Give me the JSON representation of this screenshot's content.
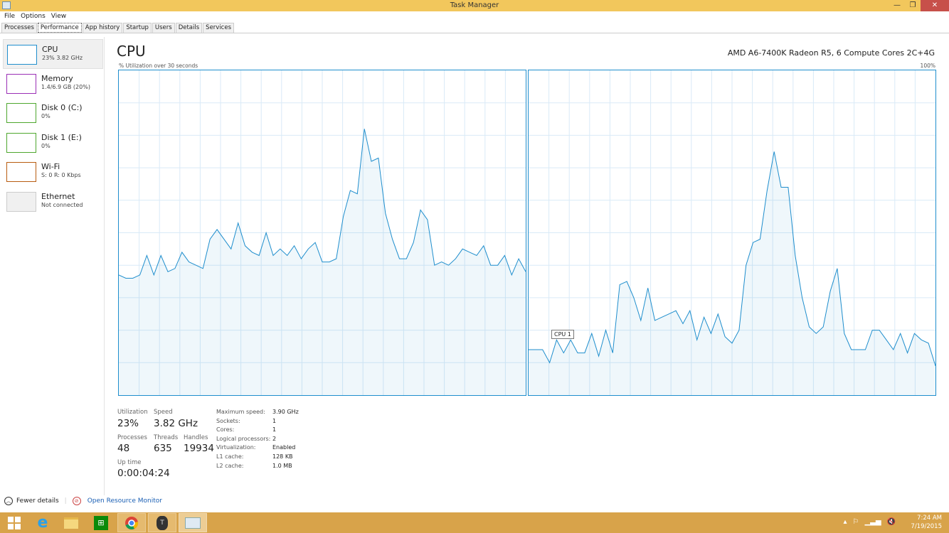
{
  "window": {
    "title": "Task Manager",
    "minimize": "—",
    "maximize": "❐",
    "close": "✕"
  },
  "menu": [
    "File",
    "Options",
    "View"
  ],
  "tabs": [
    "Processes",
    "Performance",
    "App history",
    "Startup",
    "Users",
    "Details",
    "Services"
  ],
  "active_tab": "Performance",
  "sidebar": [
    {
      "name": "CPU",
      "sub": "23%  3.82 GHz",
      "color": "#1f8ecd",
      "selected": true
    },
    {
      "name": "Memory",
      "sub": "1.4/6.9 GB (20%)",
      "color": "#9a2fb5"
    },
    {
      "name": "Disk 0 (C:)",
      "sub": "0%",
      "color": "#4ea72e"
    },
    {
      "name": "Disk 1 (E:)",
      "sub": "0%",
      "color": "#4ea72e"
    },
    {
      "name": "Wi-Fi",
      "sub": "S: 0 R: 0 Kbps",
      "color": "#b85c10"
    },
    {
      "name": "Ethernet",
      "sub": "Not connected",
      "color": "#cccccc"
    }
  ],
  "main": {
    "title": "CPU",
    "cpu_name": "AMD A6-7400K Radeon R5, 6 Compute Cores 2C+4G",
    "util_label": "% Utilization over 30 seconds",
    "max_label": "100%",
    "tooltip": "CPU 1"
  },
  "chart_data": {
    "type": "area",
    "ylim": [
      0,
      100
    ],
    "grid": true,
    "color": "#1f8ecd",
    "series": [
      {
        "values": [
          37,
          36,
          36,
          37,
          43,
          37,
          43,
          38,
          39,
          44,
          41,
          40,
          39,
          48,
          51,
          48,
          45,
          53,
          46,
          44,
          43,
          50,
          43,
          45,
          43,
          46,
          42,
          45,
          47,
          41,
          41,
          42,
          55,
          63,
          62,
          82,
          72,
          73,
          56,
          48,
          42,
          42,
          47,
          57,
          54,
          40,
          41,
          40,
          42,
          45,
          44,
          43,
          46,
          40,
          40,
          43,
          37,
          42,
          38
        ]
      },
      {
        "name": "CPU 1",
        "values": [
          14,
          14,
          14,
          10,
          17,
          13,
          17,
          13,
          13,
          19,
          12,
          20,
          13,
          34,
          35,
          30,
          23,
          33,
          23,
          24,
          25,
          26,
          22,
          26,
          17,
          24,
          19,
          25,
          18,
          16,
          20,
          40,
          47,
          48,
          63,
          75,
          64,
          64,
          43,
          30,
          21,
          19,
          21,
          32,
          39,
          19,
          14,
          14,
          14,
          20,
          20,
          17,
          14,
          19,
          13,
          19,
          17,
          16,
          9
        ]
      }
    ]
  },
  "stats": {
    "utilization": {
      "label": "Utilization",
      "value": "23%"
    },
    "speed": {
      "label": "Speed",
      "value": "3.82 GHz"
    },
    "processes": {
      "label": "Processes",
      "value": "48"
    },
    "threads": {
      "label": "Threads",
      "value": "635"
    },
    "handles": {
      "label": "Handles",
      "value": "19934"
    },
    "uptime": {
      "label": "Up time",
      "value": "0:00:04:24"
    }
  },
  "specs": [
    {
      "k": "Maximum speed:",
      "v": "3.90 GHz"
    },
    {
      "k": "Sockets:",
      "v": "1"
    },
    {
      "k": "Cores:",
      "v": "1"
    },
    {
      "k": "Logical processors:",
      "v": "2"
    },
    {
      "k": "Virtualization:",
      "v": "Enabled"
    },
    {
      "k": "L1 cache:",
      "v": "128 KB"
    },
    {
      "k": "L2 cache:",
      "v": "1.0 MB"
    }
  ],
  "footer": {
    "fewer": "Fewer details",
    "monitor": "Open Resource Monitor"
  },
  "taskbar": {
    "apps": [
      "start",
      "internet-explorer",
      "file-explorer",
      "store",
      "chrome",
      "world-of-tanks",
      "task-manager"
    ],
    "time": "7:24 AM",
    "date": "7/19/2015"
  }
}
